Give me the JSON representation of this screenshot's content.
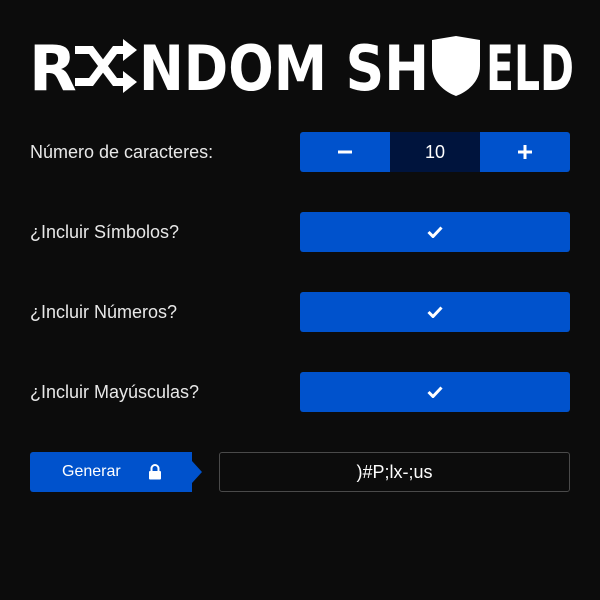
{
  "app": {
    "logo_text": "RANDOM SHIELD"
  },
  "colors": {
    "background": "#0c0c0c",
    "accent": "#0052cc",
    "stepper_value_bg": "#00143d",
    "output_border": "#4a4a4a",
    "text": "#e8e8e8"
  },
  "options": {
    "length": {
      "label": "Número de caracteres:",
      "value": "10",
      "decrement_icon": "minus-icon",
      "increment_icon": "plus-icon"
    },
    "symbols": {
      "label": "¿Incluir Símbolos?",
      "checked": true,
      "icon": "check-icon"
    },
    "numbers": {
      "label": "¿Incluir Números?",
      "checked": true,
      "icon": "check-icon"
    },
    "uppercase": {
      "label": "¿Incluir Mayúsculas?",
      "checked": true,
      "icon": "check-icon"
    }
  },
  "generate": {
    "label": "Generar",
    "icon": "lock-icon"
  },
  "output": {
    "value": ")#P;lx-;us"
  }
}
